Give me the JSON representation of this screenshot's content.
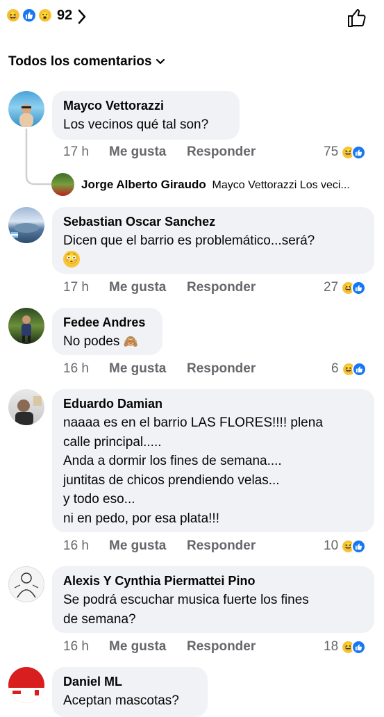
{
  "reactions": {
    "count": "92",
    "icons": [
      "haha-icon",
      "like-icon",
      "wow-icon"
    ]
  },
  "sort_label": "Todos los comentarios",
  "comments": [
    {
      "author": "Mayco Vettorazzi",
      "text": "Los vecinos qué tal son?",
      "time": "17 h",
      "like": "Me gusta",
      "reply": "Responder",
      "count": "75"
    },
    {
      "author": "Sebastian Oscar Sanchez",
      "text": "Dicen que el barrio es problemático...será?",
      "emoji": "flushed-face",
      "time": "17 h",
      "like": "Me gusta",
      "reply": "Responder",
      "count": "27"
    },
    {
      "author": "Fedee Andres",
      "text": "No podes",
      "emoji": "see-no-evil-monkey",
      "time": "16 h",
      "like": "Me gusta",
      "reply": "Responder",
      "count": "6"
    },
    {
      "author": "Eduardo Damian",
      "text": "naaaa es en el barrio LAS FLORES!!!! plena\ncalle principal.....\nAnda a dormir los fines de semana....\njuntitas de chicos prendiendo velas...\ny todo eso...\nni en pedo, por esa plata!!!",
      "time": "16 h",
      "like": "Me gusta",
      "reply": "Responder",
      "count": "10"
    },
    {
      "author": "Alexis Y Cynthia Piermattei Pino",
      "text": "Se podrá escuchar musica fuerte los fines\nde semana?",
      "time": "16 h",
      "like": "Me gusta",
      "reply": "Responder",
      "count": "18"
    },
    {
      "author": "Daniel ML",
      "text": "Aceptan mascotas?"
    }
  ],
  "reply_preview": {
    "author": "Jorge Alberto Giraudo",
    "text": "Mayco Vettorazzi Los veci..."
  },
  "colors": {
    "bubble": "#f0f2f5",
    "like_blue": "#1877f2",
    "haha_yellow": "#f7c53a",
    "meta_gray": "#65676b"
  }
}
